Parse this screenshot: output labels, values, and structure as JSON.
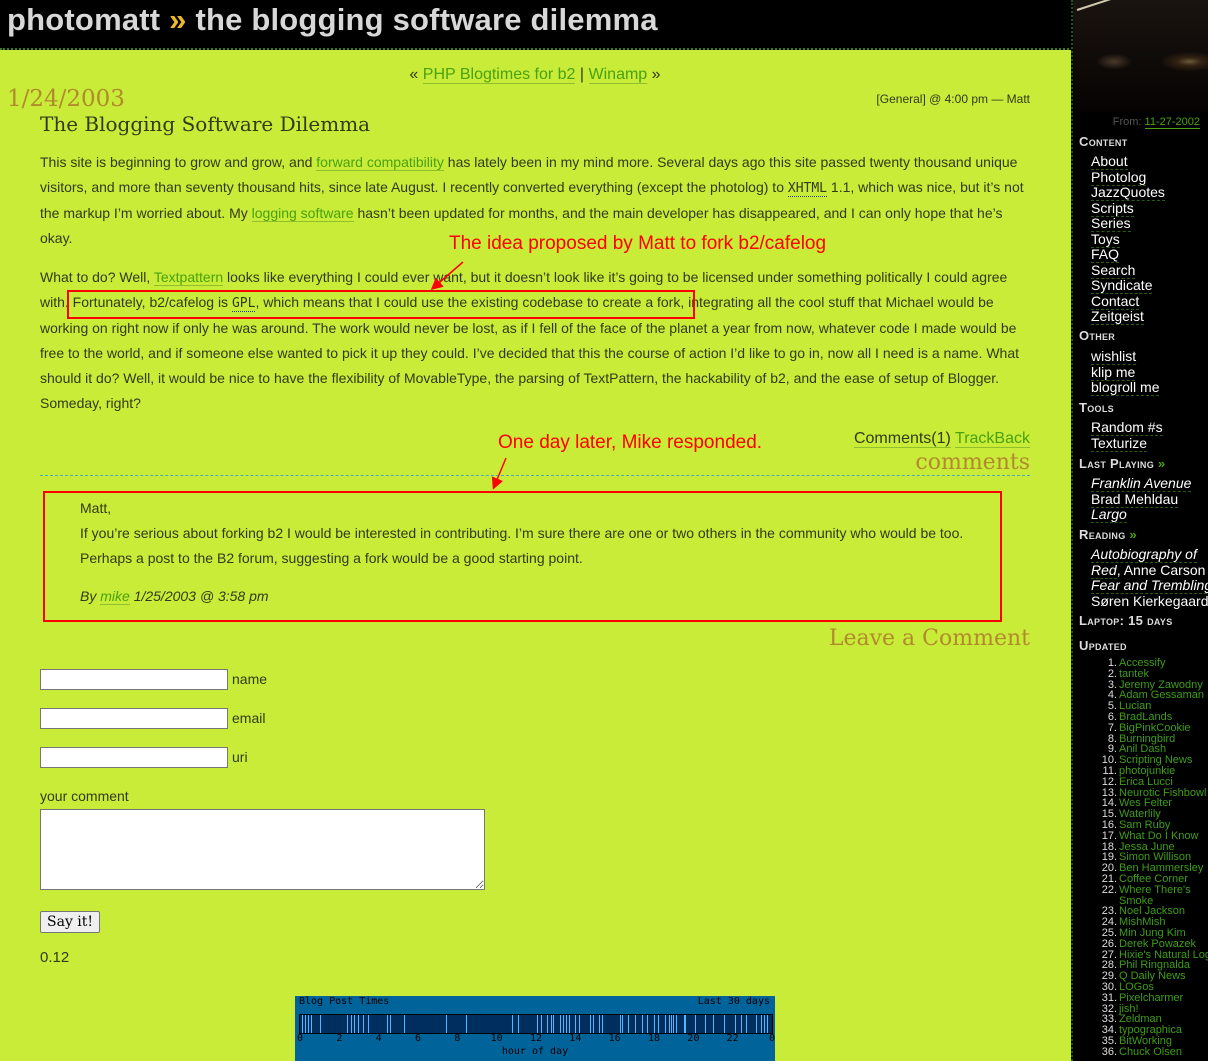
{
  "header": {
    "site": "photomatt",
    "separator": "»",
    "page_title": "the blogging software dilemma"
  },
  "nav": {
    "prev_marker": "«",
    "prev_label": "PHP Blogtimes for b2",
    "divider": "|",
    "next_label": "Winamp",
    "next_marker": "»"
  },
  "post": {
    "date": "1/24/2003",
    "meta": "[General] @ 4:00 pm — Matt",
    "title": "The Blogging Software Dilemma",
    "p1": {
      "t1": "This site is beginning to grow and grow, and ",
      "link1": "forward compatibility",
      "t2": " has lately been in my mind more. Several days ago this site passed twenty thousand unique visitors, and more than seventy thousand hits, since late August. I recently converted everything (except the photolog) to ",
      "abbr": "XHTML",
      "t3": " 1.1, which was nice, but it’s not the markup I’m worried about. My ",
      "link2": "logging software",
      "t4": " hasn’t been updated for months, and the main developer has disappeared, and I can only hope that he’s okay."
    },
    "p2": {
      "t1": "What to do? Well, ",
      "link1": "Textpattern",
      "t2": " looks like everything I could ever want, but it doesn’t look like it’s going to be licensed under something politically I could agree with. Fortunately, b2/cafelog is ",
      "abbr": "GPL",
      "t3": ", which means that I could use the existing codebase to create a fork, integrating all the cool stuff that Michael would be working on right now if only he was around. The work would never be lost, as if I fell of the face of the planet a year from now, whatever code I made would be free to the world, and if someone else wanted to pick it up they could. I’ve decided that this the course of action I’d like to go in, now all I need is a name. What should it do? Well, it would be nice to have the flexibility of MovableType, the parsing of TextPattern, the hackability of b2, and the ease of setup of Blogger. Someday, right?"
    },
    "comments_link": "Comments(1)",
    "trackback_link": "TrackBack"
  },
  "annotations": {
    "a1": "The idea proposed by Matt to fork b2/cafelog",
    "a2": "One day later, Mike responded."
  },
  "comments": {
    "heading": "comments",
    "items": [
      {
        "greeting": "Matt,",
        "line1": "If you’re serious about forking b2 I would be interested in contributing. I’m sure there are one or two others in the community who would be too.",
        "line2": "Perhaps a post to the B2 forum, suggesting a fork would be a good starting point.",
        "by": "By",
        "author": "mike",
        "timestamp": "1/25/2003 @ 3:58 pm"
      }
    ]
  },
  "form": {
    "heading": "Leave a Comment",
    "name_label": "name",
    "name_value": "",
    "email_label": "email",
    "email_value": "",
    "uri_label": "uri",
    "uri_value": "",
    "comment_label": "your comment",
    "comment_value": "",
    "submit_label": "Say it!",
    "version": "0.12"
  },
  "blogtimes": {
    "title": "Blog Post Times",
    "range": "Last 30 days",
    "xlabel": "hour of day",
    "tick_labels": [
      "0",
      "2",
      "4",
      "6",
      "8",
      "10",
      "12",
      "14",
      "16",
      "18",
      "20",
      "22",
      "0"
    ],
    "post_hours": [
      0.1,
      0.25,
      0.4,
      0.55,
      1.0,
      2.4,
      2.6,
      2.75,
      2.95,
      3.2,
      3.45,
      4.4,
      4.6,
      5.3,
      7.4,
      8.45,
      10.8,
      11.1,
      12.05,
      12.25,
      12.55,
      12.75,
      12.85,
      13.2,
      13.35,
      13.55,
      13.7,
      14.0,
      14.2,
      14.75,
      14.9,
      15.2,
      15.35,
      16.25,
      16.35,
      16.7,
      17.05,
      17.4,
      17.65,
      18.0,
      18.2,
      18.55,
      18.75,
      18.85,
      18.95,
      19.1,
      19.5,
      19.6,
      20.1,
      20.6,
      21.0,
      21.55,
      22.1,
      22.4,
      22.7,
      23.2,
      23.45,
      23.6,
      23.75
    ]
  },
  "sidebar": {
    "from_label": "From:",
    "from_date": "11-27-2002",
    "content_heading": "Content",
    "content_items": [
      "About",
      "Photolog",
      "JazzQuotes",
      "Scripts",
      "Series",
      "Toys",
      "FAQ",
      "Search",
      "Syndicate",
      "Contact",
      "Zeitgeist"
    ],
    "other_heading": "Other",
    "other_items": [
      "wishlist",
      "klip me",
      "blogroll me"
    ],
    "tools_heading": "Tools",
    "tools_items": [
      "Random #s",
      "Texturize"
    ],
    "last_playing_heading": "Last Playing",
    "last_playing_more": "»",
    "last_playing": {
      "track": "Franklin Avenue",
      "artist": "Brad Mehldau",
      "album": "Largo"
    },
    "reading_heading": "Reading",
    "reading_more": "»",
    "reading": [
      {
        "title_a": "Autobiography of",
        "title_b": "Red",
        "author": ", Anne Carson"
      },
      {
        "title": "Fear and Trembling",
        "author": "Søren Kierkegaard"
      }
    ],
    "laptop_label": "Laptop:",
    "laptop_value": "15",
    "laptop_unit": "days",
    "updated_heading": "Updated",
    "updated_items": [
      "Accessify",
      "tantek",
      "Jeremy Zawodny",
      "Adam Gessaman",
      "Lucian",
      "BradLands",
      "BigPinkCookie",
      "Burningbird",
      "Anil Dash",
      "Scripting News",
      "photojunkie",
      "Erica Lucci",
      "Neurotic Fishbowl",
      "Wes Felter",
      "Waterlily",
      "Sam Ruby",
      "What Do I Know",
      "Jessa June",
      "Simon Willison",
      "Ben Hammersley",
      "Coffee Corner",
      "Where There's Smoke",
      "Noel Jackson",
      "MishMish",
      "Min Jung Kim",
      "Derek Powazek",
      "Hixie's Natural Log",
      "Phil Ringnalda",
      "Q Daily News",
      "LOGos",
      "Pixelcharmer",
      "jish!",
      "Zeldman",
      "typographica",
      "BitWorking",
      "Chuck Olsen"
    ]
  }
}
